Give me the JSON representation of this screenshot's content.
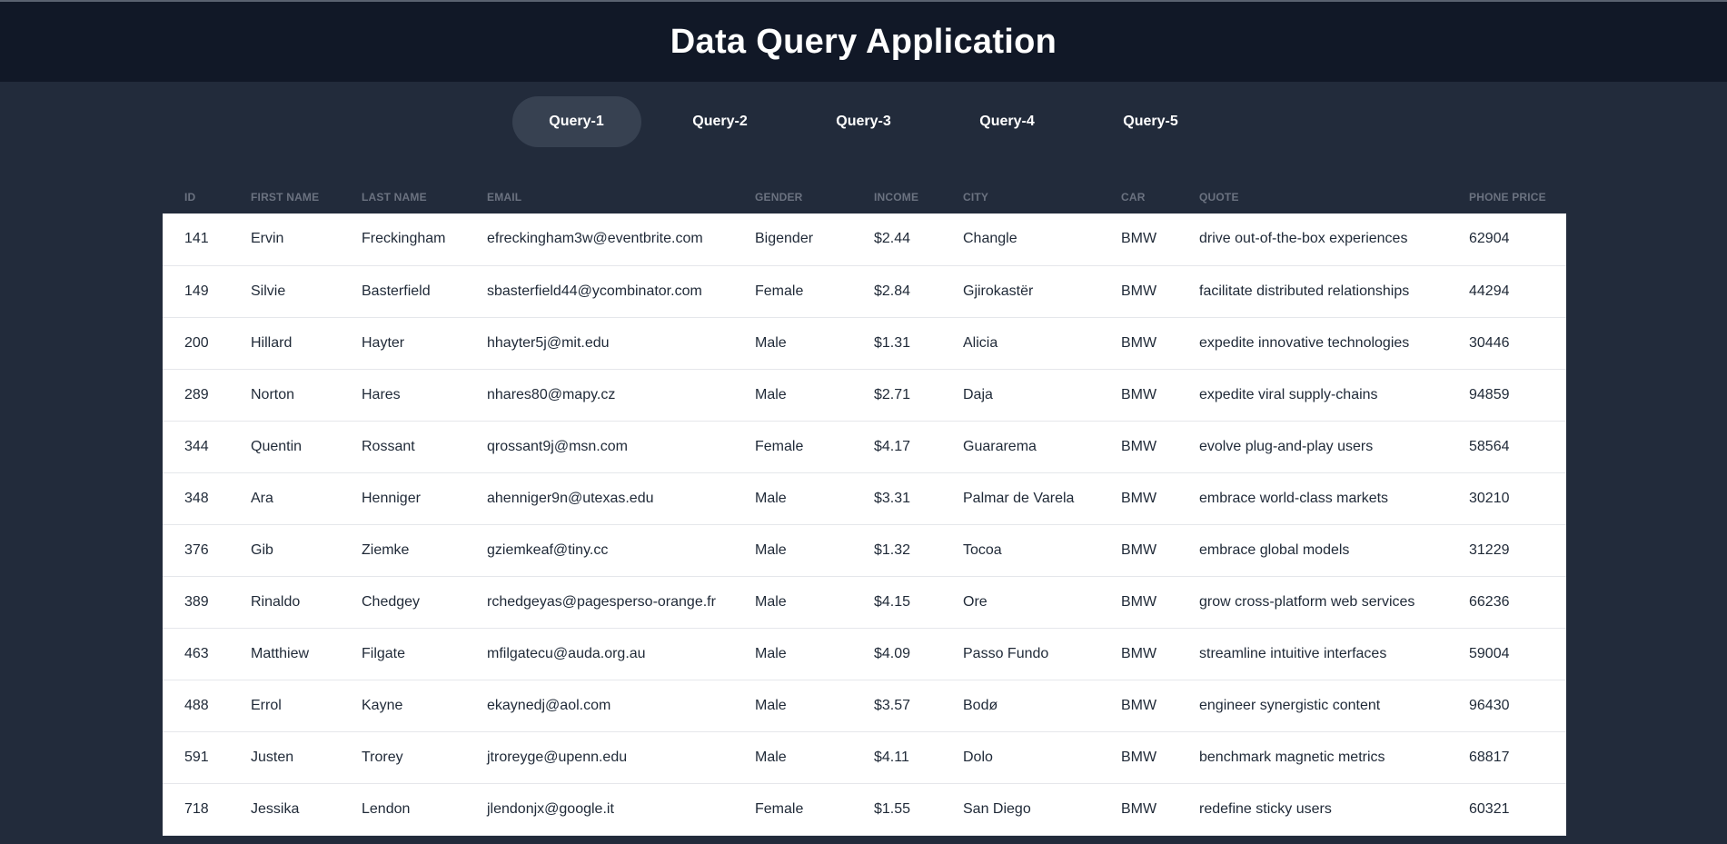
{
  "app": {
    "title": "Data Query Application"
  },
  "tabs": [
    {
      "label": "Query-1",
      "active": true
    },
    {
      "label": "Query-2",
      "active": false
    },
    {
      "label": "Query-3",
      "active": false
    },
    {
      "label": "Query-4",
      "active": false
    },
    {
      "label": "Query-5",
      "active": false
    }
  ],
  "table": {
    "columns": [
      "ID",
      "FIRST NAME",
      "LAST NAME",
      "EMAIL",
      "GENDER",
      "INCOME",
      "CITY",
      "CAR",
      "QUOTE",
      "PHONE PRICE"
    ],
    "rows": [
      [
        "141",
        "Ervin",
        "Freckingham",
        "efreckingham3w@eventbrite.com",
        "Bigender",
        "$2.44",
        "Changle",
        "BMW",
        "drive out-of-the-box experiences",
        "62904"
      ],
      [
        "149",
        "Silvie",
        "Basterfield",
        "sbasterfield44@ycombinator.com",
        "Female",
        "$2.84",
        "Gjirokastër",
        "BMW",
        "facilitate distributed relationships",
        "44294"
      ],
      [
        "200",
        "Hillard",
        "Hayter",
        "hhayter5j@mit.edu",
        "Male",
        "$1.31",
        "Alicia",
        "BMW",
        "expedite innovative technologies",
        "30446"
      ],
      [
        "289",
        "Norton",
        "Hares",
        "nhares80@mapy.cz",
        "Male",
        "$2.71",
        "Daja",
        "BMW",
        "expedite viral supply-chains",
        "94859"
      ],
      [
        "344",
        "Quentin",
        "Rossant",
        "qrossant9j@msn.com",
        "Female",
        "$4.17",
        "Guararema",
        "BMW",
        "evolve plug-and-play users",
        "58564"
      ],
      [
        "348",
        "Ara",
        "Henniger",
        "ahenniger9n@utexas.edu",
        "Male",
        "$3.31",
        "Palmar de Varela",
        "BMW",
        "embrace world-class markets",
        "30210"
      ],
      [
        "376",
        "Gib",
        "Ziemke",
        "gziemkeaf@tiny.cc",
        "Male",
        "$1.32",
        "Tocoa",
        "BMW",
        "embrace global models",
        "31229"
      ],
      [
        "389",
        "Rinaldo",
        "Chedgey",
        "rchedgeyas@pagesperso-orange.fr",
        "Male",
        "$4.15",
        "Ore",
        "BMW",
        "grow cross-platform web services",
        "66236"
      ],
      [
        "463",
        "Matthiew",
        "Filgate",
        "mfilgatecu@auda.org.au",
        "Male",
        "$4.09",
        "Passo Fundo",
        "BMW",
        "streamline intuitive interfaces",
        "59004"
      ],
      [
        "488",
        "Errol",
        "Kayne",
        "ekaynedj@aol.com",
        "Male",
        "$3.57",
        "Bodø",
        "BMW",
        "engineer synergistic content",
        "96430"
      ],
      [
        "591",
        "Justen",
        "Trorey",
        "jtroreyge@upenn.edu",
        "Male",
        "$4.11",
        "Dolo",
        "BMW",
        "benchmark magnetic metrics",
        "68817"
      ],
      [
        "718",
        "Jessika",
        "Lendon",
        "jlendonjx@google.it",
        "Female",
        "$1.55",
        "San Diego",
        "BMW",
        "redefine sticky users",
        "60321"
      ]
    ]
  },
  "colors": {
    "page_bg": "#222b3b",
    "header_bg": "#111827",
    "active_tab_bg": "#374151",
    "column_header_text": "#6b7280"
  }
}
